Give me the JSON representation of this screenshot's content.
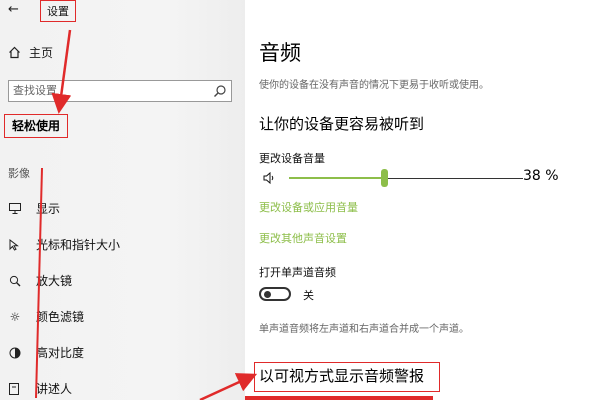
{
  "window": {
    "back_icon": "back-arrow-icon",
    "title": "设置"
  },
  "sidebar": {
    "home_label": "主页",
    "search_placeholder": "查找设置",
    "category": "轻松使用",
    "section_label": "影像",
    "items": [
      {
        "label": "显示",
        "icon": "display-icon"
      },
      {
        "label": "光标和指针大小",
        "icon": "cursor-icon"
      },
      {
        "label": "放大镜",
        "icon": "magnifier-icon"
      },
      {
        "label": "颜色滤镜",
        "icon": "color-filter-icon"
      },
      {
        "label": "高对比度",
        "icon": "high-contrast-icon"
      },
      {
        "label": "讲述人",
        "icon": "narrator-icon"
      }
    ]
  },
  "main": {
    "title": "音频",
    "description": "使你的设备在没有声音的情况下更易于收听或使用。",
    "section_title": "让你的设备更容易被听到",
    "volume_label": "更改设备音量",
    "volume_value_text": "38 %",
    "volume_level": 0.38,
    "link_app_volume": "更改设备或应用音量",
    "link_other_sound": "更改其他声音设置",
    "mono_label": "打开单声道音频",
    "mono_state": "关",
    "mono_note": "单声道音频将左声道和右声道合并成一个声道。",
    "visual_title": "以可视方式显示音频警报"
  },
  "colors": {
    "accent": "#8dbe4a",
    "annotation_red": "#e02a2a"
  }
}
